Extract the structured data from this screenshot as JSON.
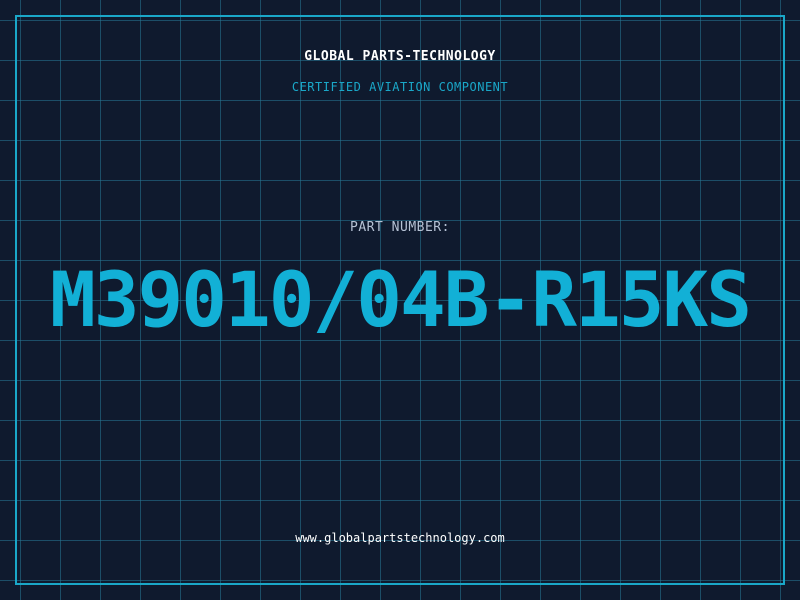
{
  "header": {
    "company": "GLOBAL PARTS-TECHNOLOGY",
    "tagline": "CERTIFIED AVIATION COMPONENT"
  },
  "main": {
    "label": "PART NUMBER:",
    "part_number": "M39010/04B-R15KS"
  },
  "footer": {
    "url": "www.globalpartstechnology.com"
  },
  "colors": {
    "background": "#0f1a2e",
    "accent": "#12b0d6",
    "grid": "#26789a",
    "text": "#ffffff",
    "muted": "#b6c2d4"
  }
}
